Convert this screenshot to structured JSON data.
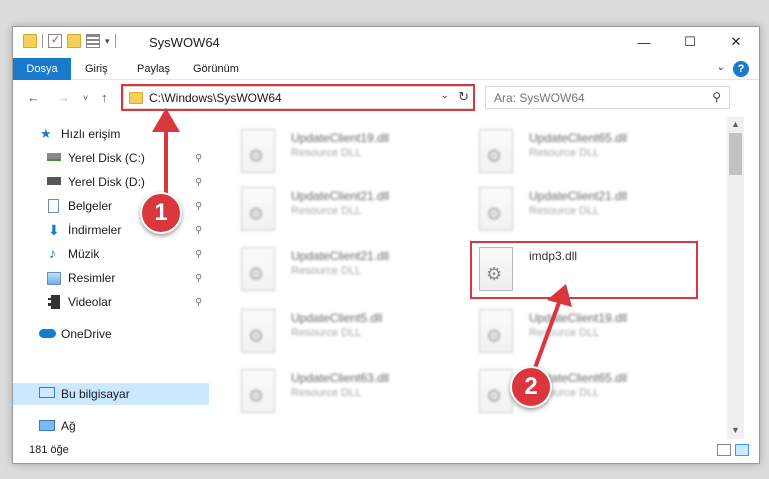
{
  "window": {
    "title": "SysWOW64"
  },
  "ribbon": {
    "tabs": [
      "Dosya",
      "Giriş",
      "Paylaş",
      "Görünüm"
    ],
    "help": "?"
  },
  "address": {
    "path": "C:\\Windows\\SysWOW64"
  },
  "search": {
    "placeholder": "Ara: SysWOW64"
  },
  "sidebar": {
    "items": [
      {
        "label": "Hızlı erişim",
        "icon": "star-icon",
        "pinned": false
      },
      {
        "label": "Yerel Disk (C:)",
        "icon": "drive-icon",
        "pinned": true
      },
      {
        "label": "Yerel Disk (D:)",
        "icon": "drive-icon",
        "pinned": true
      },
      {
        "label": "Belgeler",
        "icon": "documents-icon",
        "pinned": true
      },
      {
        "label": "İndirmeler",
        "icon": "download-icon",
        "pinned": true
      },
      {
        "label": "Müzik",
        "icon": "music-icon",
        "pinned": true
      },
      {
        "label": "Resimler",
        "icon": "pictures-icon",
        "pinned": true
      },
      {
        "label": "Videolar",
        "icon": "videos-icon",
        "pinned": true
      },
      {
        "label": "OneDrive",
        "icon": "cloud-icon",
        "pinned": false
      },
      {
        "label": "Bu bilgisayar",
        "icon": "computer-icon",
        "pinned": false,
        "selected": true
      },
      {
        "label": "Ağ",
        "icon": "network-icon",
        "pinned": false
      }
    ]
  },
  "files": [
    {
      "name": "UpdateClient19.dll",
      "desc": "Resource DLL"
    },
    {
      "name": "UpdateClient65.dll",
      "desc": "Resource DLL"
    },
    {
      "name": "UpdateClient21.dll",
      "desc": "Resource DLL"
    },
    {
      "name": "UpdateClient21.dll",
      "desc": "Resource DLL"
    },
    {
      "name": "UpdateClient21.dll",
      "desc": "Resource DLL"
    },
    {
      "name": "imdp3.dll",
      "desc": "",
      "highlighted": true
    },
    {
      "name": "UpdateClient5.dll",
      "desc": "Resource DLL"
    },
    {
      "name": "UpdateClient19.dll",
      "desc": "Resource DLL"
    },
    {
      "name": "UpdateClient63.dll",
      "desc": "Resource DLL"
    },
    {
      "name": "UpdateClient65.dll",
      "desc": "Resource DLL"
    }
  ],
  "status": {
    "count": "181 öğe"
  },
  "annotations": {
    "badge1": "1",
    "badge2": "2",
    "color": "#d9363e"
  },
  "icons": {
    "pin": "📌",
    "gear": "⚙"
  }
}
